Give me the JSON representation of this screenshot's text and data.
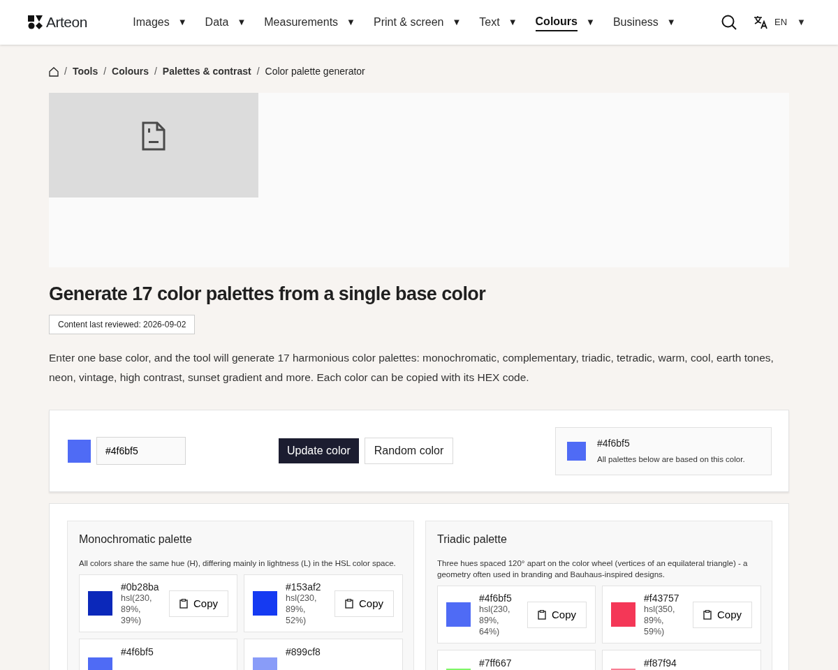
{
  "brand": {
    "name": "Arteon"
  },
  "nav": [
    {
      "label": "Images",
      "caret": "▼",
      "selected": false
    },
    {
      "label": "Data",
      "caret": "▼",
      "selected": false
    },
    {
      "label": "Measurements",
      "caret": "▼",
      "selected": false
    },
    {
      "label": "Print & screen",
      "caret": "▼",
      "selected": false
    },
    {
      "label": "Text",
      "caret": "▼",
      "selected": false
    },
    {
      "label": "Colours",
      "caret": "▼",
      "selected": true
    },
    {
      "label": "Business",
      "caret": "▼",
      "selected": false
    }
  ],
  "language": {
    "code": "EN",
    "caret": "▼"
  },
  "breadcrumb": [
    {
      "separator": "/",
      "label": "Tools",
      "current": false
    },
    {
      "separator": "/",
      "label": "Colours",
      "current": false
    },
    {
      "separator": "/",
      "label": "Palettes & contrast",
      "current": false
    },
    {
      "separator": "/",
      "label": "Color palette generator",
      "current": true
    }
  ],
  "title": "Generate 17 color palettes from a single base color",
  "reviewed": "Content last reviewed: 2026-09-02",
  "intro": "Enter one base color, and the tool will generate 17 harmonious color palettes: monochromatic, complementary, triadic, tetradic, warm, cool, earth tones, neon, vintage, high contrast, sunset gradient and more. Each color can be copied with its HEX code.",
  "tool": {
    "color": "#4f6bf5",
    "value": "#4f6bf5",
    "update": "Update color",
    "random": "Random color",
    "current_hex": "#4f6bf5",
    "note": "All palettes below are based on this color."
  },
  "palettes": [
    {
      "title": "Monochromatic palette",
      "description": "All colors share the same hue (H), differing mainly in lightness (L) in the HSL color space.",
      "colors": [
        {
          "hex": "#0b28ba",
          "hsl": "hsl(230, 89%, 39%)",
          "copy": "Copy",
          "color": "#0b28ba"
        },
        {
          "hex": "#153af2",
          "hsl": "hsl(230, 89%, 52%)",
          "copy": "Copy",
          "color": "#153af2"
        },
        {
          "hex": "#4f6bf5",
          "color": "#4f6bf5"
        },
        {
          "hex": "#899cf8",
          "color": "#899cf8"
        }
      ]
    },
    {
      "title": "Triadic palette",
      "description": "Three hues spaced 120° apart on the color wheel (vertices of an equilateral triangle) - a geometry often used in branding and Bauhaus-inspired designs.",
      "colors": [
        {
          "hex": "#4f6bf5",
          "hsl": "hsl(230, 89%, 64%)",
          "copy": "Copy",
          "color": "#4f6bf5"
        },
        {
          "hex": "#f43757",
          "hsl": "hsl(350, 89%, 59%)",
          "copy": "Copy",
          "color": "#f43757"
        },
        {
          "hex": "#7ff667",
          "color": "#7ff667"
        },
        {
          "hex": "#f87f94",
          "color": "#f87f94"
        }
      ]
    }
  ]
}
